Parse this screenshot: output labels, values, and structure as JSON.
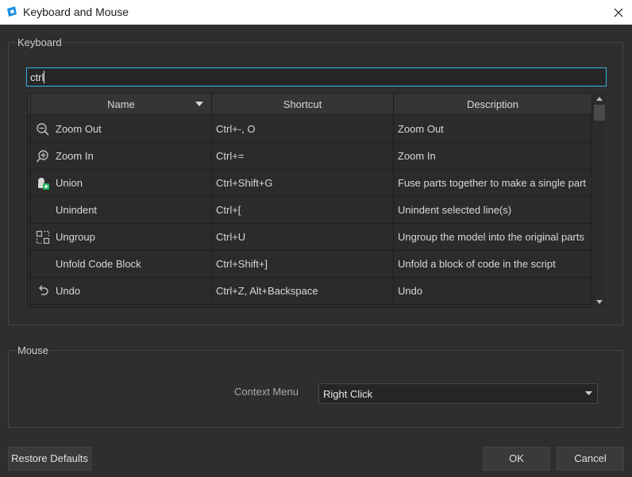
{
  "window": {
    "title": "Keyboard and Mouse",
    "close_icon": "close-icon"
  },
  "keyboard": {
    "group_title": "Keyboard",
    "search_value": "ctrl",
    "columns": [
      "Name",
      "Shortcut",
      "Description"
    ],
    "rows": [
      {
        "icon": "zoom-out-icon",
        "name": "Zoom Out",
        "shortcut": "Ctrl+-, O",
        "description": "Zoom Out"
      },
      {
        "icon": "zoom-in-icon",
        "name": "Zoom In",
        "shortcut": "Ctrl+=",
        "description": "Zoom In"
      },
      {
        "icon": "union-icon",
        "name": "Union",
        "shortcut": "Ctrl+Shift+G",
        "description": "Fuse parts together to make a single part"
      },
      {
        "icon": "",
        "name": "Unindent",
        "shortcut": "Ctrl+[",
        "description": "Unindent selected line(s)"
      },
      {
        "icon": "ungroup-icon",
        "name": "Ungroup",
        "shortcut": "Ctrl+U",
        "description": "Ungroup the model into the original parts"
      },
      {
        "icon": "",
        "name": "Unfold Code Block",
        "shortcut": "Ctrl+Shift+]",
        "description": "Unfold a block of code in the script"
      },
      {
        "icon": "undo-icon",
        "name": "Undo",
        "shortcut": "Ctrl+Z, Alt+Backspace",
        "description": "Undo"
      }
    ]
  },
  "mouse": {
    "group_title": "Mouse",
    "context_menu_label": "Context Menu",
    "context_menu_value": "Right Click"
  },
  "buttons": {
    "restore_defaults": "Restore Defaults",
    "ok": "OK",
    "cancel": "Cancel"
  },
  "colors": {
    "background": "#2e2e2e",
    "accent": "#35b2e8",
    "union_green": "#1fb35a"
  }
}
